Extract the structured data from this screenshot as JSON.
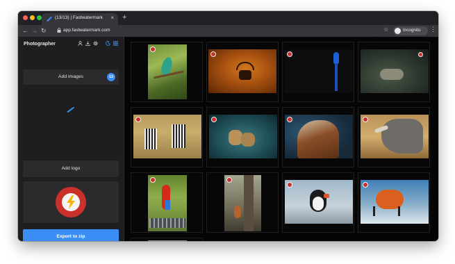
{
  "browser": {
    "tab_title": "(13/13) | Fastwatermark",
    "tab_close": "×",
    "new_tab": "+",
    "back": "←",
    "forward": "→",
    "reload": "↻",
    "lock": "🔒",
    "url": "app.fastwatermark.com",
    "star": "☆",
    "profile_label": "Incognito",
    "menu": "⋮"
  },
  "sidebar": {
    "brand": "Photographer",
    "add_images_label": "Add images",
    "image_count": "13",
    "add_logo_label": "Add logo",
    "export_label": "Export to zip"
  },
  "gallery": {
    "photos": [
      "hummingbird",
      "deer-silhouette",
      "blue-parrot",
      "snow-leopard",
      "zebras",
      "cheetahs",
      "eagle",
      "rhino",
      "macaw",
      "tree-squirrel",
      "puffin",
      "fox",
      "partial-photo"
    ]
  },
  "colors": {
    "accent": "#3a8ef6",
    "watermark_red": "#c9312a",
    "bolt_yellow": "#f4b400"
  }
}
